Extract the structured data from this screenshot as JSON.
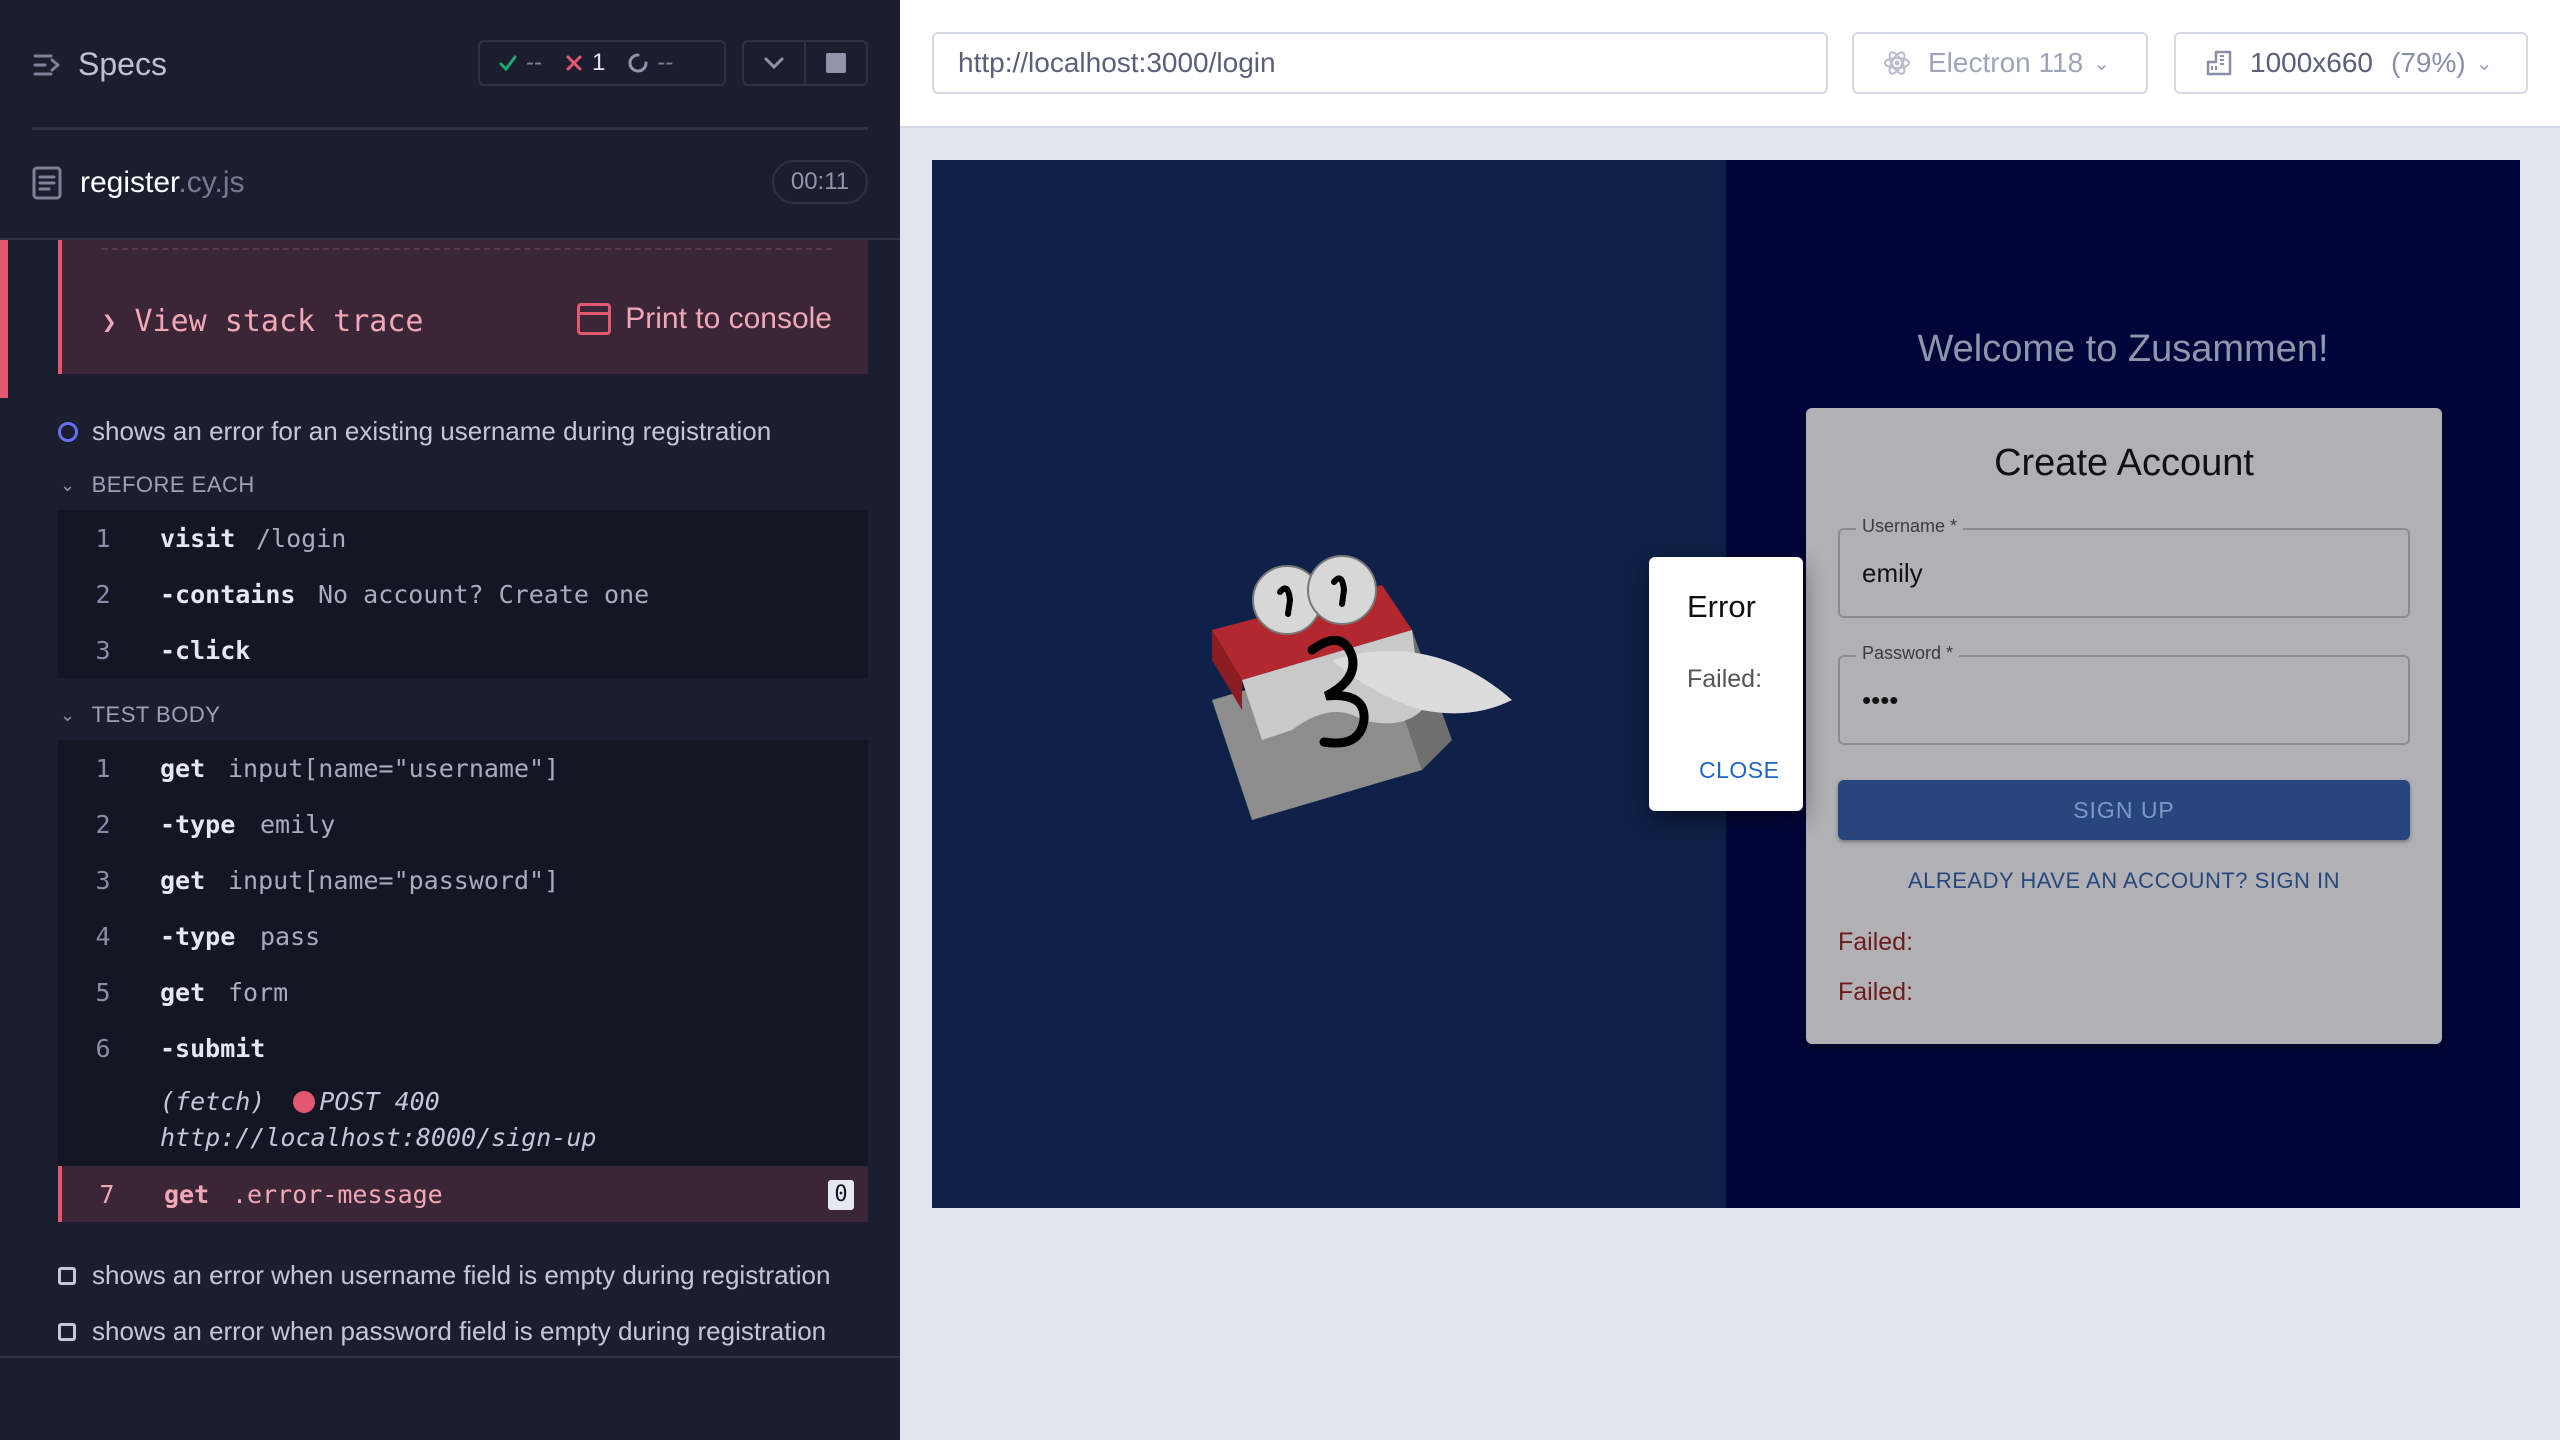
{
  "reporter": {
    "specs_title": "Specs",
    "stats": {
      "passed": "--",
      "failed": "1",
      "pending": "--"
    },
    "spec_file": {
      "name": "register",
      "ext": ".cy.js",
      "duration": "00:11"
    },
    "error": {
      "view_stack": "View stack trace",
      "print_console": "Print to console"
    },
    "tests": [
      "shows an error for an existing username during registration",
      "shows an error when username field is empty during registration",
      "shows an error when password field is empty during registration"
    ],
    "before_each": {
      "label": "BEFORE EACH",
      "commands": [
        {
          "num": "1",
          "name": "visit",
          "msg": "/login"
        },
        {
          "num": "2",
          "name": "-contains",
          "msg": "No account? Create one"
        },
        {
          "num": "3",
          "name": "-click",
          "msg": ""
        }
      ]
    },
    "test_body": {
      "label": "TEST BODY",
      "commands": [
        {
          "num": "1",
          "name": "get",
          "msg": "input[name=\"username\"]"
        },
        {
          "num": "2",
          "name": "-type",
          "msg": "emily"
        },
        {
          "num": "3",
          "name": "get",
          "msg": "input[name=\"password\"]"
        },
        {
          "num": "4",
          "name": "-type",
          "msg": "pass"
        },
        {
          "num": "5",
          "name": "get",
          "msg": "form"
        },
        {
          "num": "6",
          "name": "-submit",
          "msg": ""
        },
        {
          "num": "7",
          "name": "get",
          "msg": ".error-message"
        }
      ],
      "fetch": {
        "label": "(fetch)",
        "text": "POST 400 http://localhost:8000/sign-up"
      },
      "active_badge": "0"
    }
  },
  "aut": {
    "url": "http://localhost:3000/login",
    "browser": "Electron 118",
    "viewport": "1000x660",
    "viewport_pct": "(79%)"
  },
  "app": {
    "welcome": "Welcome to Zusammen!",
    "card_title": "Create Account",
    "username_label": "Username *",
    "username_value": "emily",
    "password_label": "Password *",
    "password_value": "••••",
    "signup_button": "SIGN UP",
    "signin_link": "ALREADY HAVE AN ACCOUNT? SIGN IN",
    "failed_messages": [
      "Failed:",
      "Failed:"
    ],
    "dialog": {
      "title": "Error",
      "body": "Failed:",
      "close": "CLOSE"
    }
  },
  "colors": {
    "reporter_bg": "#1b1e2e",
    "error_accent": "#e45770",
    "running": "#6470f3",
    "app_left_bg": "#0f2148",
    "app_right_bg": "#00063a",
    "signup_button": "#28467e"
  }
}
